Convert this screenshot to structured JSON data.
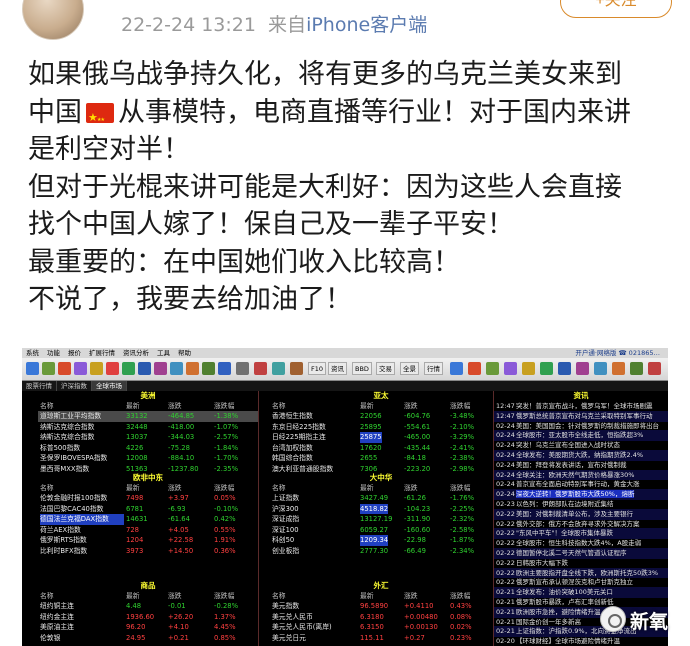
{
  "post": {
    "timestamp": "22-2-24 13:21",
    "source_prefix": "来自",
    "source": "iPhone客户端",
    "follow_label": "+关注",
    "lines": [
      "如果俄乌战争持久化，将有更多的乌克兰美女来到",
      "从事模特，电商直播等行业！对于国内来讲",
      "是利空对半！",
      "但对于光棍来讲可能是大利好：因为这些人会直接",
      "找个中国人嫁了！保自己及一辈子平安！",
      "最重要的：在中国她们收入比较高！",
      "不说了，我要去给加油了！"
    ],
    "line2_prefix": "中国",
    "flag_icon": "china-flag-icon"
  },
  "terminal": {
    "menu": [
      "系统",
      "功能",
      "报价",
      "扩展行情",
      "资讯分析",
      "工具",
      "帮助"
    ],
    "menu_right": "开户通·网络版 ☎ 021865…",
    "tabs": [
      "股票行情",
      "沪深指数",
      "全球市场"
    ],
    "toolbar_labels": [
      "F10",
      "资讯",
      "BBD",
      "交易",
      "全景",
      "行情"
    ],
    "panels": [
      {
        "title": "美洲",
        "headers": [
          "名称",
          "最新",
          "涨跌",
          "涨跌幅"
        ],
        "rows": [
          {
            "name": "道琼斯工业平均指数",
            "last": "33132",
            "chg": "-464.85",
            "pct": "-1.38%",
            "dir": "dn",
            "sel": true
          },
          {
            "name": "纳斯达克综合指数",
            "last": "32448",
            "chg": "-418.00",
            "pct": "-1.07%",
            "dir": "dn"
          },
          {
            "name": "纳斯达克综合指数",
            "last": "13037",
            "chg": "-344.03",
            "pct": "-2.57%",
            "dir": "dn"
          },
          {
            "name": "标普500指数",
            "last": "4226",
            "chg": "-75.28",
            "pct": "-1.84%",
            "dir": "dn"
          },
          {
            "name": "圣保罗IBOVESPA指数",
            "last": "12008",
            "chg": "-884.10",
            "pct": "-1.70%",
            "dir": "dn"
          },
          {
            "name": "墨西哥MXX指数",
            "last": "51363",
            "chg": "-1237.80",
            "pct": "-2.35%",
            "dir": "dn"
          }
        ]
      },
      {
        "title": "亚太",
        "headers": [
          "名称",
          "最新",
          "涨跌",
          "涨跌幅"
        ],
        "rows": [
          {
            "name": "香港恒生指数",
            "last": "22056",
            "chg": "-604.76",
            "pct": "-3.48%",
            "dir": "dn"
          },
          {
            "name": "东京日经225指数",
            "last": "25895",
            "chg": "-554.61",
            "pct": "-2.10%",
            "dir": "dn"
          },
          {
            "name": "日经225期指主连",
            "last": "25875",
            "chg": "-465.00",
            "pct": "-3.29%",
            "dir": "dn",
            "hl": true
          },
          {
            "name": "台湾加权指数",
            "last": "17620",
            "chg": "-435.44",
            "pct": "-2.41%",
            "dir": "dn"
          },
          {
            "name": "韩国综合指数",
            "last": "2655",
            "chg": "-84.18",
            "pct": "-2.38%",
            "dir": "dn"
          },
          {
            "name": "澳大利亚普通股指数",
            "last": "7306",
            "chg": "-223.20",
            "pct": "-2.98%",
            "dir": "dn"
          }
        ]
      },
      {
        "title": "欧非中东",
        "headers": [
          "名称",
          "最新",
          "涨跌",
          "涨跌幅"
        ],
        "rows": [
          {
            "name": "伦敦金融时报100指数",
            "last": "7498",
            "chg": "+3.97",
            "pct": "0.05%",
            "dir": "up"
          },
          {
            "name": "法国巴黎CAC40指数",
            "last": "6781",
            "chg": "-6.93",
            "pct": "-0.10%",
            "dir": "dn"
          },
          {
            "name": "德国法兰克福DAX指数",
            "last": "14631",
            "chg": "-61.64",
            "pct": "0.42%",
            "dir": "dn",
            "hl_name": true
          },
          {
            "name": "荷兰AEX指数",
            "last": "728",
            "chg": "+4.05",
            "pct": "0.55%",
            "dir": "up"
          },
          {
            "name": "俄罗斯RTS指数",
            "last": "1204",
            "chg": "+22.58",
            "pct": "1.91%",
            "dir": "up"
          },
          {
            "name": "比利时BFX指数",
            "last": "3973",
            "chg": "+14.50",
            "pct": "0.36%",
            "dir": "up"
          }
        ]
      },
      {
        "title": "大中华",
        "headers": [
          "名称",
          "最新",
          "涨跌",
          "涨跌幅"
        ],
        "rows": [
          {
            "name": "上证指数",
            "last": "3427.49",
            "chg": "-61.26",
            "pct": "-1.76%",
            "dir": "dn"
          },
          {
            "name": "沪深300",
            "last": "4518.82",
            "chg": "-104.23",
            "pct": "-2.25%",
            "dir": "dn",
            "hl": true
          },
          {
            "name": "深证成指",
            "last": "13127.19",
            "chg": "-311.90",
            "pct": "-2.32%",
            "dir": "dn"
          },
          {
            "name": "深证100",
            "last": "6059.27",
            "chg": "-160.60",
            "pct": "-2.58%",
            "dir": "dn"
          },
          {
            "name": "科创50",
            "last": "1209.34",
            "chg": "-22.98",
            "pct": "-1.87%",
            "dir": "dn",
            "hl": true
          },
          {
            "name": "创业板指",
            "last": "2777.30",
            "chg": "-66.49",
            "pct": "-2.34%",
            "dir": "dn"
          }
        ]
      },
      {
        "title": "商品",
        "headers": [
          "名称",
          "最新",
          "涨跌",
          "涨跌幅"
        ],
        "rows": [
          {
            "name": "纽约铜主连",
            "last": "4.48",
            "chg": "-0.01",
            "pct": "-0.28%",
            "dir": "dn"
          },
          {
            "name": "纽约金主连",
            "last": "1936.60",
            "chg": "+26.20",
            "pct": "1.37%",
            "dir": "up"
          },
          {
            "name": "美原油主连",
            "last": "96.20",
            "chg": "+4.10",
            "pct": "4.45%",
            "dir": "up"
          },
          {
            "name": "伦敦银",
            "last": "24.95",
            "chg": "+0.21",
            "pct": "0.85%",
            "dir": "up"
          }
        ]
      },
      {
        "title": "外汇",
        "headers": [
          "名称",
          "最新",
          "涨跌",
          "涨跌幅"
        ],
        "rows": [
          {
            "name": "美元指数",
            "last": "96.5890",
            "chg": "+0.4110",
            "pct": "0.43%",
            "dir": "up"
          },
          {
            "name": "美元兑人民币",
            "last": "6.3180",
            "chg": "+0.00480",
            "pct": "0.08%",
            "dir": "up"
          },
          {
            "name": "美元兑人民币(离岸)",
            "last": "6.3150",
            "chg": "+0.00130",
            "pct": "0.02%",
            "dir": "up"
          },
          {
            "name": "美元兑日元",
            "last": "115.11",
            "chg": "+0.27",
            "pct": "0.23%",
            "dir": "up"
          }
        ]
      }
    ],
    "news_title": "资讯",
    "news": [
      {
        "t": "12:47",
        "x": "突发！普京宣布战斗，俄罗乌军！全球市场剧震"
      },
      {
        "t": "12:47",
        "x": "俄罗斯总统普京宣布对乌克兰采取特别军事行动"
      },
      {
        "t": "02-24",
        "x": "美国：美国国会：针对俄罗斯的制裁措施即将出台"
      },
      {
        "t": "02-24",
        "x": "全球股市：亚太股市全线走低，恒指跌超3%"
      },
      {
        "t": "02-24",
        "x": "突发！乌克兰宣布全国进入战时状态"
      },
      {
        "t": "02-24",
        "x": "全球发布：美股期货大跌，纳指期货跌2.4%"
      },
      {
        "t": "02-24",
        "x": "美国：拜登将发表讲话，宣布对俄制裁"
      },
      {
        "t": "02-24",
        "x": "全球关注：欧洲天然气期货价格暴涨30%"
      },
      {
        "t": "02-24",
        "x": "普京宣布全面启动特别军事行动，黄金大涨"
      },
      {
        "t": "02-24",
        "x": "深夜大逆转！俄罗斯股市大跌50%，熔断"
      },
      {
        "t": "02-23",
        "x": "以色列：伊朗部队在边境附近集结"
      },
      {
        "t": "02-22",
        "x": "美国：对俄制裁清单公布，涉及主要银行"
      },
      {
        "t": "02-22",
        "x": "俄外交部：俄方不会放弃寻求外交解决方案"
      },
      {
        "t": "02-22",
        "x": "\"东风中平车\"！全球股市集体暴跌"
      },
      {
        "t": "02-22",
        "x": "全球股市：恒生科技指数大跌4%，A股走弱"
      },
      {
        "t": "02-22",
        "x": "德国暂停北溪二号天然气管道认证程序"
      },
      {
        "t": "02-22",
        "x": "日韩股市大幅下跌"
      },
      {
        "t": "02-22",
        "x": "欧洲主要股指开盘全线下跌，欧洲斯托克50跌3%"
      },
      {
        "t": "02-22",
        "x": "俄罗斯宣布承认顿涅茨克和卢甘斯克独立"
      },
      {
        "t": "02-21",
        "x": "全球发布：油价突破100美元关口"
      },
      {
        "t": "02-21",
        "x": "俄罗斯股市暴跌，卢布汇率创新低"
      },
      {
        "t": "02-21",
        "x": "欧洲股市急挫，避险情绪升温"
      },
      {
        "t": "02-21",
        "x": "国际金价创一年多新高"
      },
      {
        "t": "02-21",
        "x": "上证指数：沪指跌0.9%，北向资金净流出"
      },
      {
        "t": "02-20",
        "x": "【环球财经】全球市场避险情绪升温"
      }
    ]
  },
  "watermark": {
    "text": "新氧",
    "icon": "xinyang-logo-icon"
  }
}
